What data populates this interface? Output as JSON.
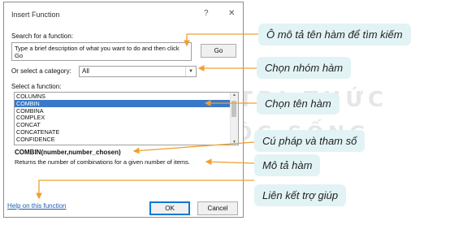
{
  "watermark": {
    "line1": "KẾT NỐI TRI THỨC",
    "line2": "VỚI CUỘC SỐNG"
  },
  "dialog": {
    "title": "Insert Function",
    "help_glyph": "?",
    "close_glyph": "✕",
    "search_label": "Search for a function:",
    "search_text": "Type a brief description of what you want to do and then click Go",
    "go_label": "Go",
    "category_label": "Or select a category:",
    "category_value": "All",
    "select_label": "Select a function:",
    "functions": [
      "COLUMNS",
      "COMBIN",
      "COMBINA",
      "COMPLEX",
      "CONCAT",
      "CONCATENATE",
      "CONFIDENCE"
    ],
    "selected_function": "COMBIN",
    "syntax": "COMBIN(number,number_chosen)",
    "description": "Returns the number of combinations for a given number of items.",
    "help_link": "Help on this function",
    "ok_label": "OK",
    "cancel_label": "Cancel"
  },
  "callouts": {
    "search": "Ô mô tả tên hàm để tìm kiếm",
    "category": "Chọn nhóm hàm",
    "function": "Chọn tên hàm",
    "syntax": "Cú pháp và tham số",
    "description": "Mô tả hàm",
    "help": "Liên kết trợ giúp"
  },
  "colors": {
    "callout_bg": "#e2f3f5",
    "arrow": "#f0a030",
    "selection": "#3a78c9",
    "link": "#1a5fb4"
  }
}
